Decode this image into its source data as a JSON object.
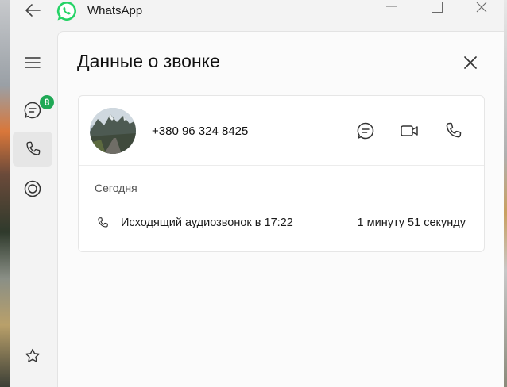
{
  "window": {
    "app_title": "WhatsApp",
    "controls": [
      "minimize-icon",
      "maximize-icon",
      "close-icon"
    ]
  },
  "rail": {
    "items": [
      {
        "icon": "menu-icon"
      },
      {
        "icon": "chats-icon",
        "badge": "8"
      },
      {
        "icon": "calls-icon",
        "active": true
      },
      {
        "icon": "status-icon"
      },
      {
        "icon": "starred-icon"
      }
    ]
  },
  "call_details": {
    "title": "Данные о звонке",
    "contact": {
      "phone": "+380 96 324 8425",
      "actions": [
        "message-icon",
        "video-call-icon",
        "voice-call-icon"
      ]
    },
    "section_date": "Сегодня",
    "calls": [
      {
        "description": "Исходящий аудиозвонок в 17:22",
        "duration": "1 минуту 51 секунду"
      }
    ]
  },
  "colors": {
    "accent": "#1fa855",
    "background": "#f3f3f3",
    "pane": "#fbfbfb"
  }
}
